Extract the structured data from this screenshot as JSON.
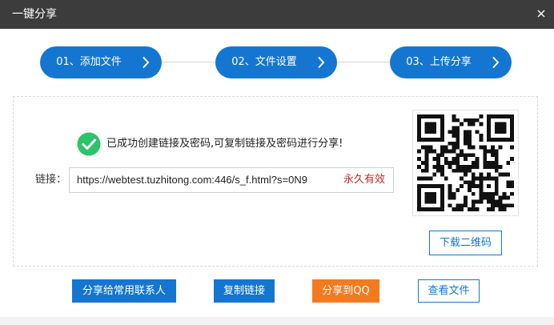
{
  "dialog": {
    "title": "一键分享",
    "close_icon": "close-icon"
  },
  "steps": [
    {
      "label": "01、添加文件",
      "icon": "chevron-right-icon"
    },
    {
      "label": "02、文件设置",
      "icon": "chevron-right-icon"
    },
    {
      "label": "03、上传分享",
      "icon": "chevron-right-icon"
    }
  ],
  "result": {
    "icon": "check-circle-icon",
    "message": "已成功创建链接及密码,可复制链接及密码进行分享!"
  },
  "link": {
    "label": "链接：",
    "url": "https://webtest.tuzhitong.com:446/s_f.html?s=0N9",
    "validity": "永久有效"
  },
  "qr": {
    "icon": "qr-code-image",
    "download_label": "下载二维码"
  },
  "actions": {
    "share_contacts": "分享给常用联系人",
    "copy_link": "复制链接",
    "share_qq": "分享到QQ",
    "view_file": "查看文件"
  },
  "colors": {
    "primary": "#1476d1",
    "orange": "#f47a20",
    "success": "#2cc36b",
    "validity_red": "#c82727",
    "titlebar": "#3c3c3c"
  }
}
